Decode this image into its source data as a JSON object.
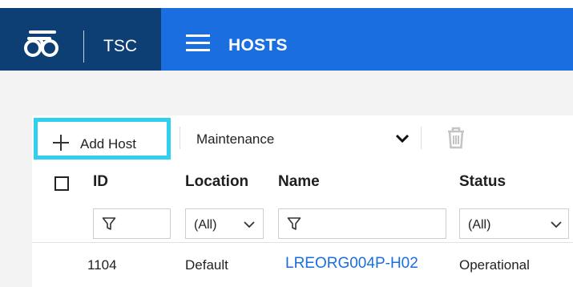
{
  "header": {
    "app_name": "TSC",
    "page_title": "HOSTS",
    "colors": {
      "brand_bg": "#0e3f74",
      "bar_bg": "#1a6ee0",
      "highlight": "#2fd0f0"
    }
  },
  "toolbar": {
    "add_host_label": "Add Host",
    "maintenance_label": "Maintenance"
  },
  "table": {
    "columns": {
      "id": "ID",
      "location": "Location",
      "name": "Name",
      "status": "Status"
    },
    "filters": {
      "location": "(All)",
      "status": "(All)"
    },
    "rows": [
      {
        "id": "1104",
        "location": "Default",
        "name": "LREORG004P-H02",
        "status": "Operational"
      }
    ]
  }
}
